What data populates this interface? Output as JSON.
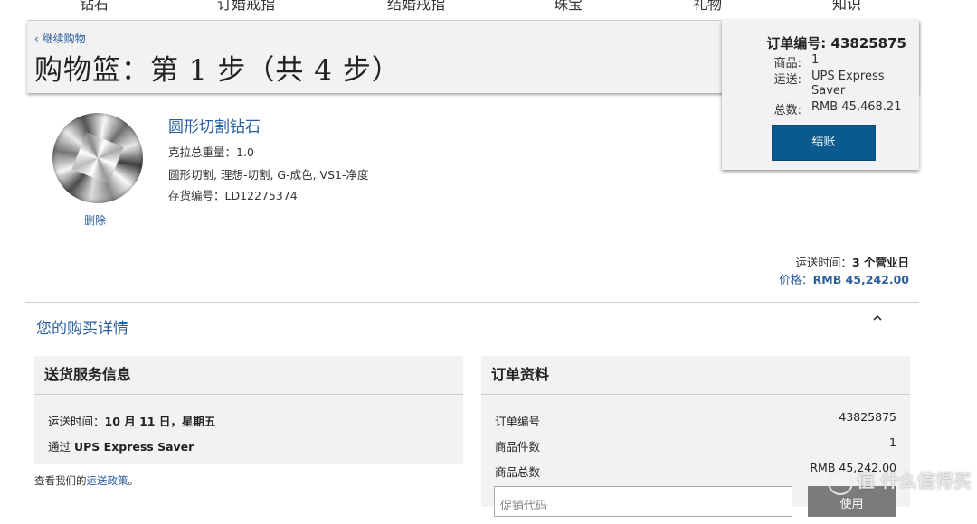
{
  "nav": [
    "钻石",
    "订婚戒指",
    "结婚戒指",
    "珠宝",
    "礼物",
    "知识"
  ],
  "header": {
    "back_link": "‹ 继续购物",
    "title": "购物篮：第 1 步（共 4 步）"
  },
  "summary": {
    "order_label": "订单编号: 43825875",
    "items_label": "商品:",
    "items_value": "1",
    "shipping_label": "运送:",
    "shipping_value": "UPS Express Saver",
    "total_label": "总数:",
    "total_value": "RMB 45,468.21",
    "checkout_button": "结账"
  },
  "product": {
    "name": "圆形切割钻石",
    "carat_label": "克拉总重量：",
    "carat_value": "1.0",
    "description": "圆形切割, 理想-切割, G-成色, VS1-净度",
    "sku_label": "存货编号：",
    "sku_value": "LD12275374",
    "remove_link": "删除",
    "image_icon": "diamond-image"
  },
  "delivery": {
    "time_label": "运送时间：",
    "time_value": "3 个营业日",
    "price_label": "价格：",
    "price_value": "RMB 45,242.00"
  },
  "details": {
    "heading": "您的购买详情",
    "toggle_icon": "chevron-up-icon"
  },
  "shipping_panel": {
    "title": "送货服务信息",
    "date_label": "运送时间：",
    "date_value": "10 月 11 日，星期五",
    "method_prefix": "通过 ",
    "method_value": "UPS Express Saver"
  },
  "policy_note": {
    "prefix": "查看我们的",
    "link": "运送政策",
    "suffix": "。"
  },
  "order_panel": {
    "title": "订单资料",
    "rows": [
      {
        "label": "订单编号",
        "value": "43825875"
      },
      {
        "label": "商品件数",
        "value": "1"
      },
      {
        "label": "商品总数",
        "value": "RMB 45,242.00"
      }
    ],
    "promo_placeholder": "促销代码",
    "apply_button": "使用"
  },
  "watermark": "值 什么值得买",
  "colors": {
    "link": "#2a5f9e",
    "button": "#0b5a8f",
    "panel_bg": "#f2f2f2"
  }
}
